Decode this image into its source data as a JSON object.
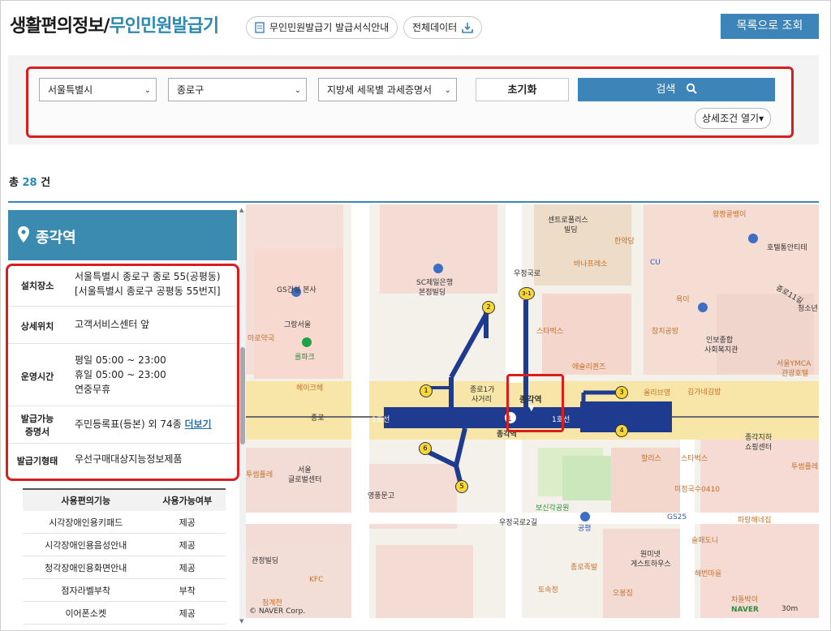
{
  "header": {
    "title_main": "생활편의정보/",
    "title_sub": "무인민원발급기",
    "guide_button": "무인민원발급기 발급서식안내",
    "all_data_button": "전체데이터",
    "list_button": "목록으로 조회"
  },
  "search": {
    "city": "서울특별시",
    "district": "종로구",
    "document": "지방세 세목별 과세증명서",
    "reset_label": "초기화",
    "search_label": "검색",
    "detail_label": "상세조건 열기"
  },
  "result": {
    "prefix": "총",
    "count": "28",
    "suffix": "건"
  },
  "place": {
    "name": "종각역",
    "rows": [
      {
        "key": "설치장소",
        "value_line1": "서울특별시 종로구 종로 55(공평동)",
        "value_line2": "[서울특별시 종로구 공평동 55번지]"
      },
      {
        "key": "상세위치",
        "value_line1": "고객서비스센터 앞"
      },
      {
        "key": "운영시간",
        "value_line1": "평일 05:00 ~ 23:00",
        "value_line2": "휴일 05:00 ~ 23:00",
        "value_line3": "연중무휴"
      },
      {
        "key_line1": "발급가능",
        "key_line2": "증명서",
        "value_line1": "주민등록표(등본) 외 74종",
        "more": "더보기"
      },
      {
        "key": "발급기형태",
        "value_line1": "우선구매대상지능정보제품"
      }
    ]
  },
  "facilities": {
    "headers": [
      "사용편의기능",
      "사용가능여부"
    ],
    "rows": [
      [
        "시각장애인용키패드",
        "제공"
      ],
      [
        "시각장애인용음성안내",
        "제공"
      ],
      [
        "청각장애인용화면안내",
        "제공"
      ],
      [
        "점자라벨부착",
        "부착"
      ],
      [
        "이어폰소켓",
        "제공"
      ]
    ]
  },
  "map": {
    "station": "종각역",
    "station_below": "종각역",
    "line_label": "1호선",
    "exits": [
      "1",
      "2",
      "3",
      "3-1",
      "4",
      "5",
      "6"
    ],
    "labels": {
      "centropolis": "센트로폴리스",
      "building": "빌딩",
      "hanyudang": "한약당",
      "banapresso": "바나프레소",
      "cu": "CU",
      "wangjjang": "왕짱골뱅이",
      "hotel": "호텔통안티테",
      "sc_bank": "SC제일은행",
      "sc_bank2": "본점빌딩",
      "gs_hq": "GS건설 본사",
      "graham": "그랑서울",
      "pharmacy": "마로약국",
      "drugstore": "롤파크",
      "heiqu": "헤이크헤",
      "starbucks": "스타벅스",
      "eulji_js": "애슐리퀸즈",
      "chamchi": "참치공방",
      "inbo": "인보종합",
      "inbo2": "사회복지관",
      "ymca": "서울YMCA",
      "ymca2": "관광호텔",
      "jongno1": "종로1가",
      "jongno1b": "사거리",
      "olive": "올리브영",
      "kimne": "김가네김밥",
      "hollys": "할리스",
      "starbucks2": "스타벅스",
      "jonggak_mall": "종각지하",
      "jonggak_mall2": "쇼핑센터",
      "twosome": "투썸플레",
      "mijeong": "미정국수0410",
      "gs25": "GS25",
      "paris": "파랑해네집",
      "seoul_gl": "서울",
      "seoul_gl2": "글로벌센터",
      "youngpoong": "영풍문고",
      "bosingak": "보신각공원",
      "gongpyeong": "공평",
      "kwanjeong": "관정빌딩",
      "kfc": "KFC",
      "jongno_jok": "종로족발",
      "tokatsu": "토속정",
      "ohbok": "오봉집",
      "wonminet": "원미넷",
      "guesthouse": "게스트하우스",
      "haebeon": "해번마을",
      "sulbakdoni": "술패도니",
      "chadol": "차돌박이",
      "jeonggye": "청계천",
      "road_woojeong": "우정국로",
      "road_woojeong2": "우정국로2길",
      "road_jongno": "종로",
      "road_11": "종로11길",
      "cheongsol": "청소년",
      "gukbap": "욕이",
      "naver_corp": "© NAVER Corp.",
      "naver": "NAVER",
      "scale": "30m"
    }
  },
  "colors": {
    "accent": "#3d84b8",
    "highlight_red": "#d91e1e",
    "subway_blue": "#1f3b8f",
    "exit_yellow": "#f6d63a"
  }
}
